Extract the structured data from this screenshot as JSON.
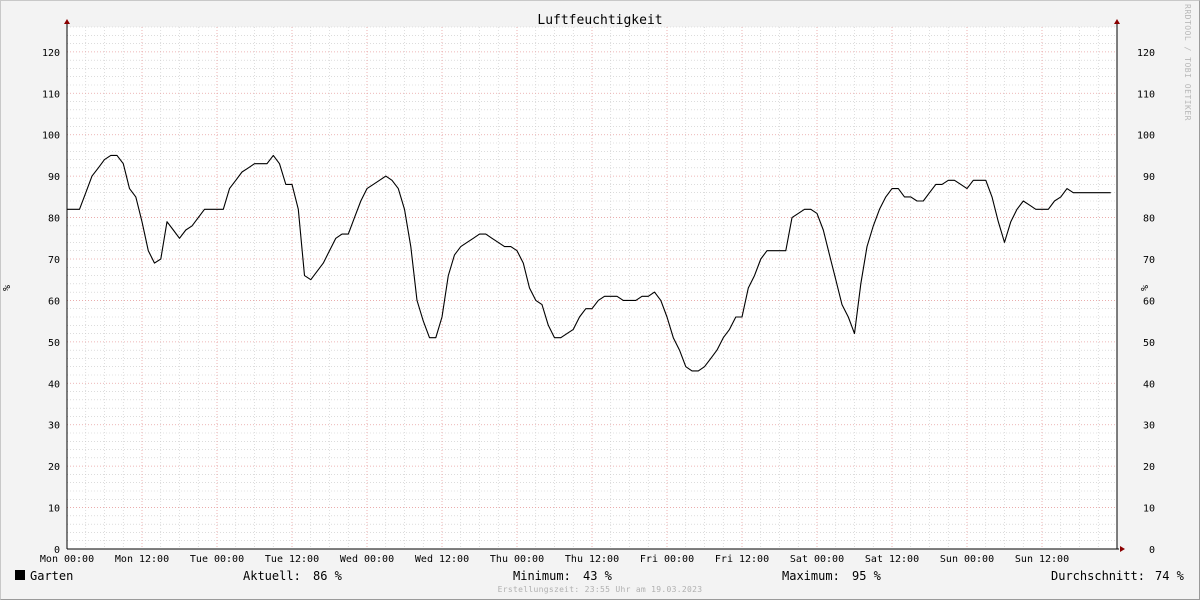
{
  "chart_data": {
    "type": "line",
    "title": "Luftfeuchtigkeit",
    "ylabel": "%",
    "ylim": [
      0,
      126
    ],
    "y_ticks": [
      0,
      10,
      20,
      30,
      40,
      50,
      60,
      70,
      80,
      90,
      100,
      110,
      120
    ],
    "x_tick_labels": [
      "Mon 00:00",
      "Mon 12:00",
      "Tue 00:00",
      "Tue 12:00",
      "Wed 00:00",
      "Wed 12:00",
      "Thu 00:00",
      "Thu 12:00",
      "Fri 00:00",
      "Fri 12:00",
      "Sat 00:00",
      "Sat 12:00",
      "Sun 00:00",
      "Sun 12:00"
    ],
    "x_unit": "hours since Mon 00:00",
    "xlim": [
      0,
      168
    ],
    "grid": true,
    "series": [
      {
        "name": "Garten",
        "color": "#000000",
        "x": [
          0,
          1,
          2,
          3,
          4,
          5,
          6,
          7,
          8,
          9,
          10,
          11,
          12,
          13,
          14,
          15,
          16,
          17,
          18,
          19,
          20,
          21,
          22,
          23,
          24,
          25,
          26,
          27,
          28,
          29,
          30,
          31,
          32,
          33,
          34,
          35,
          36,
          37,
          38,
          39,
          40,
          41,
          42,
          43,
          44,
          45,
          46,
          47,
          48,
          49,
          50,
          51,
          52,
          53,
          54,
          55,
          56,
          57,
          58,
          59,
          60,
          61,
          62,
          63,
          64,
          65,
          66,
          67,
          68,
          69,
          70,
          71,
          72,
          73,
          74,
          75,
          76,
          77,
          78,
          79,
          80,
          81,
          82,
          83,
          84,
          85,
          86,
          87,
          88,
          89,
          90,
          91,
          92,
          93,
          94,
          95,
          96,
          97,
          98,
          99,
          100,
          101,
          102,
          103,
          104,
          105,
          106,
          107,
          108,
          109,
          110,
          111,
          112,
          113,
          114,
          115,
          116,
          117,
          118,
          119,
          120,
          121,
          122,
          123,
          124,
          125,
          126,
          127,
          128,
          129,
          130,
          131,
          132,
          133,
          134,
          135,
          136,
          137,
          138,
          139,
          140,
          141,
          142,
          143,
          144,
          145,
          146,
          147,
          148,
          149,
          150,
          151,
          152,
          153,
          154,
          155,
          156,
          157,
          158,
          159,
          160,
          161,
          162,
          163,
          164,
          165,
          166,
          167
        ],
        "values": [
          82,
          82,
          82,
          86,
          90,
          92,
          94,
          95,
          95,
          93,
          87,
          85,
          79,
          72,
          69,
          70,
          79,
          77,
          75,
          77,
          78,
          80,
          82,
          82,
          82,
          82,
          87,
          89,
          91,
          92,
          93,
          93,
          93,
          95,
          93,
          88,
          88,
          82,
          66,
          65,
          67,
          69,
          72,
          75,
          76,
          76,
          80,
          84,
          87,
          88,
          89,
          90,
          89,
          87,
          82,
          73,
          60,
          55,
          51,
          51,
          56,
          66,
          71,
          73,
          74,
          75,
          76,
          76,
          75,
          74,
          73,
          73,
          72,
          69,
          63,
          60,
          59,
          54,
          51,
          51,
          52,
          53,
          56,
          58,
          58,
          60,
          61,
          61,
          61,
          60,
          60,
          60,
          61,
          61,
          62,
          60,
          56,
          51,
          48,
          44,
          43,
          43,
          44,
          46,
          48,
          51,
          53,
          56,
          56,
          63,
          66,
          70,
          72,
          72,
          72,
          72,
          80,
          81,
          82,
          82,
          81,
          77,
          71,
          65,
          59,
          56,
          52,
          64,
          73,
          78,
          82,
          85,
          87,
          87,
          85,
          85,
          84,
          84,
          86,
          88,
          88,
          89,
          89,
          88,
          87,
          89,
          89,
          89,
          85,
          79,
          74,
          79,
          82,
          84,
          83,
          82,
          82,
          82,
          84,
          85,
          87,
          86,
          86,
          86,
          86,
          86,
          86,
          86
        ]
      }
    ]
  },
  "legend": {
    "series_name": "Garten",
    "current_label": "Aktuell:",
    "current_value": "86 %",
    "min_label": "Minimum:",
    "min_value": "43 %",
    "max_label": "Maximum:",
    "max_value": "95 %",
    "avg_label": "Durchschnitt:",
    "avg_value": "74 %"
  },
  "footer": "Erstellungszeit: 23:55 Uhr am 19.03.2023",
  "watermark": "RRDTOOL / TOBI OETIKER",
  "colors": {
    "background": "#f3f3f3",
    "plot_background": "#ffffff",
    "major_grid": "#e8a0a0",
    "minor_grid": "#c8c8c8",
    "line": "#000000",
    "arrow": "#8b0000"
  }
}
